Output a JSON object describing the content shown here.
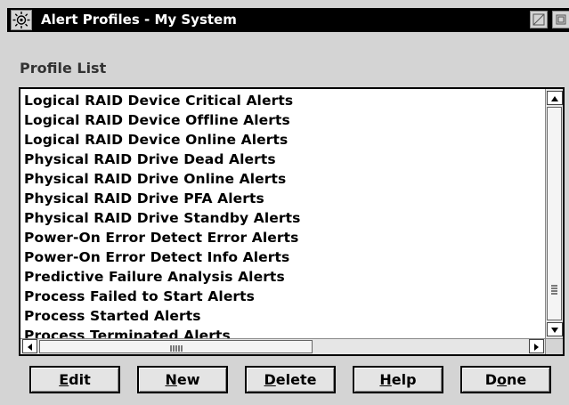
{
  "window": {
    "title": "Alert Profiles - My System",
    "icon": "gear-icon"
  },
  "profile_list": {
    "label": "Profile List",
    "items": [
      "Logical RAID Device Critical Alerts",
      "Logical RAID Device Offline Alerts",
      "Logical RAID Device Online Alerts",
      "Physical RAID Drive Dead Alerts",
      "Physical RAID Drive Online Alerts",
      "Physical RAID Drive PFA Alerts",
      "Physical RAID Drive Standby Alerts",
      "Power-On Error Detect Error Alerts",
      "Power-On Error Detect Info Alerts",
      "Predictive Failure Analysis Alerts",
      "Process Failed to Start Alerts",
      "Process Started Alerts",
      "Process Terminated Alerts"
    ]
  },
  "buttons": {
    "edit": {
      "prefix": "",
      "mnemonic": "E",
      "rest": "dit"
    },
    "new": {
      "prefix": "",
      "mnemonic": "N",
      "rest": "ew"
    },
    "delete": {
      "prefix": "",
      "mnemonic": "D",
      "rest": "elete"
    },
    "help": {
      "prefix": "",
      "mnemonic": "H",
      "rest": "elp"
    },
    "done": {
      "prefix": "D",
      "mnemonic": "o",
      "rest": "ne"
    }
  }
}
